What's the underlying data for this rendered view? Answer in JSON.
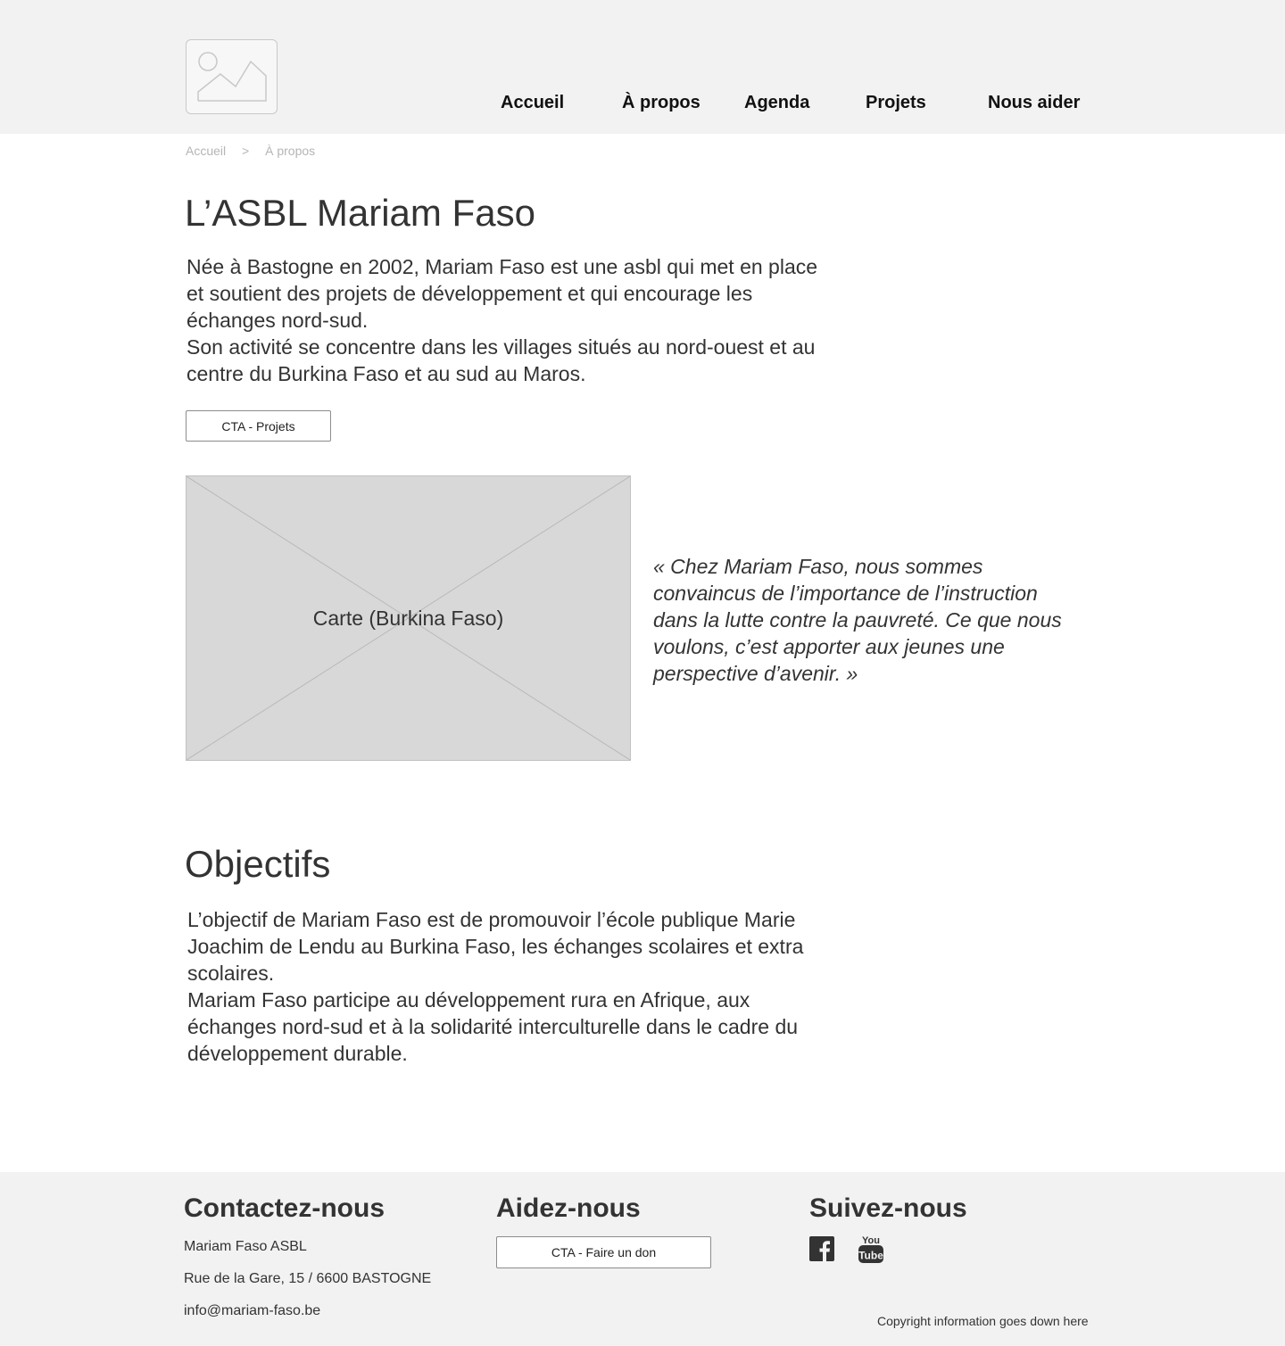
{
  "header": {
    "logo_alt": "",
    "nav": [
      {
        "label": "Accueil"
      },
      {
        "label": "À propos"
      },
      {
        "label": "Agenda"
      },
      {
        "label": "Projets"
      },
      {
        "label": "Nous aider"
      }
    ]
  },
  "breadcrumb": {
    "items": [
      "Accueil",
      "À propos"
    ],
    "separator": ">"
  },
  "about": {
    "title": "L’ASBL Mariam Faso",
    "paragraph_lines": [
      "Née à Bastogne en 2002, Mariam Faso est une asbl qui met en place",
      "et soutient des projets de développement et qui encourage les",
      "échanges nord-sud.",
      "Son activité se concentre dans les villages situés au nord-ouest et au",
      "centre du Burkina Faso et au sud au Maros."
    ],
    "cta_label": "CTA - Projets",
    "map_label": "Carte (Burkina Faso)",
    "quote_lines": [
      "« Chez Mariam Faso, nous sommes",
      "convaincus de l’importance de l’instruction",
      "dans la lutte contre la pauvreté. Ce que nous",
      "voulons, c’est apporter aux jeunes une",
      "perspective d’avenir. »"
    ]
  },
  "objectives": {
    "title": "Objectifs",
    "paragraph_lines": [
      "L’objectif de Mariam Faso est de promouvoir l’école publique Marie",
      "Joachim de Lendu au Burkina Faso, les échanges scolaires et extra",
      "scolaires.",
      "Mariam Faso participe au développement rura en Afrique, aux",
      "échanges nord-sud et à la solidarité interculturelle dans le cadre du",
      "développement durable."
    ]
  },
  "footer": {
    "contact": {
      "title": "Contactez-nous",
      "name": "Mariam Faso ASBL",
      "address": "Rue de la Gare, 15 / 6600 BASTOGNE",
      "email": "info@mariam-faso.be"
    },
    "help": {
      "title": "Aidez-nous",
      "cta_label": "CTA - Faire un don"
    },
    "follow": {
      "title": "Suivez-nous",
      "icons": [
        "facebook-icon",
        "youtube-icon"
      ],
      "youtube_text_top": "You",
      "youtube_text_bottom": "Tube"
    },
    "copyright": "Copyright information goes down here"
  },
  "colors": {
    "header_bg": "#f2f2f2",
    "footer_bg": "#f2f2f2",
    "text": "#333333",
    "placeholder": "#d8d8d8"
  }
}
